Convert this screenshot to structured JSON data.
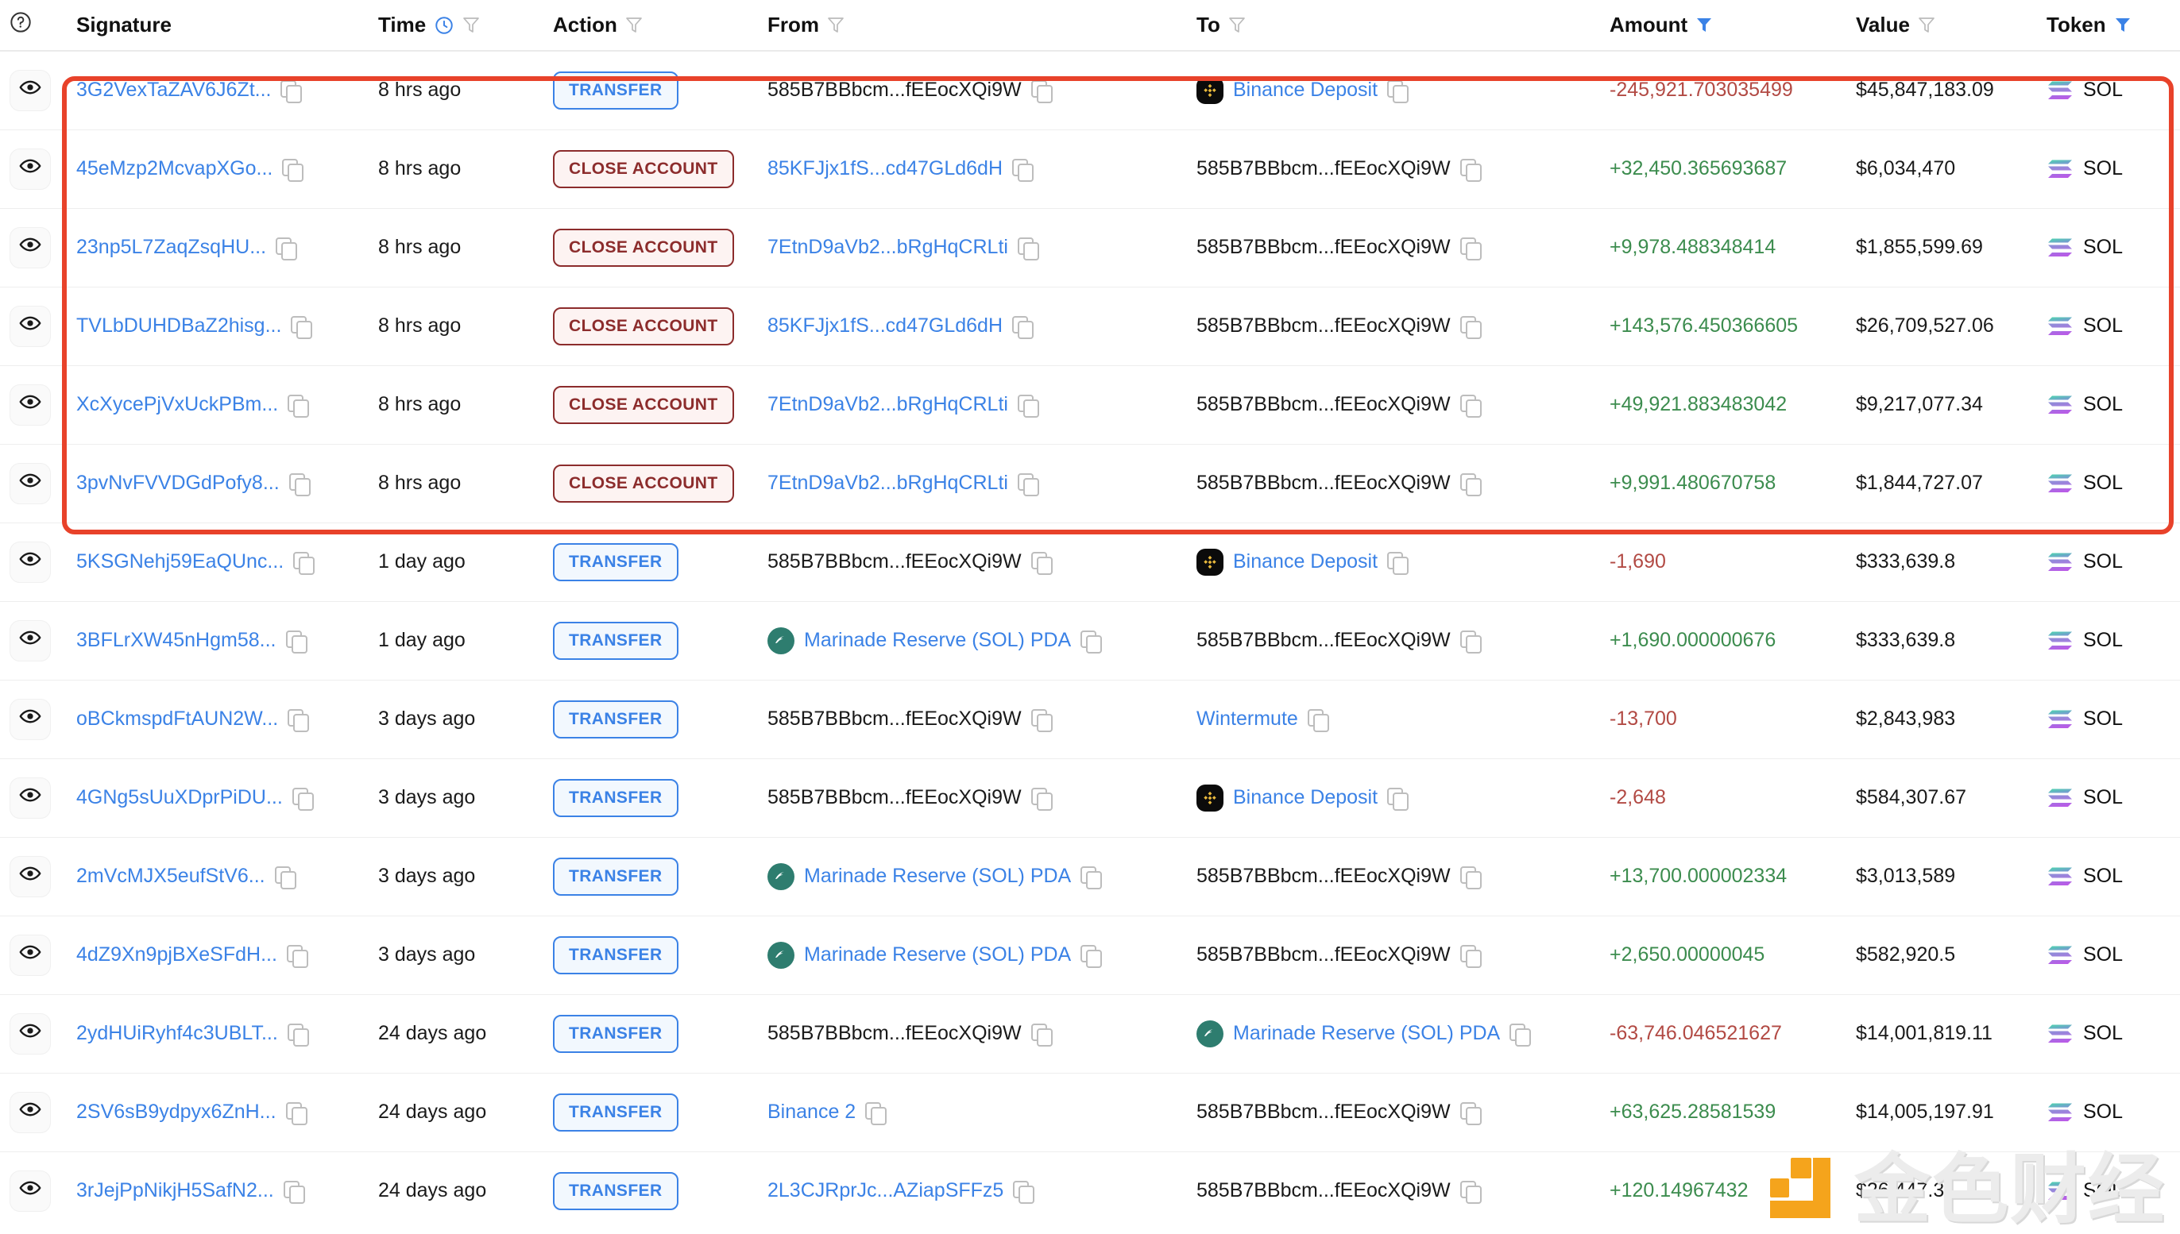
{
  "table": {
    "columns": [
      {
        "key": "eye",
        "label": "",
        "icons": [
          "help-icon"
        ]
      },
      {
        "key": "sig",
        "label": "Signature",
        "icons": []
      },
      {
        "key": "time",
        "label": "Time",
        "icons": [
          "clock-icon",
          "filter-icon"
        ]
      },
      {
        "key": "action",
        "label": "Action",
        "icons": [
          "filter-icon"
        ]
      },
      {
        "key": "from",
        "label": "From",
        "icons": [
          "filter-icon"
        ]
      },
      {
        "key": "to",
        "label": "To",
        "icons": [
          "filter-icon"
        ]
      },
      {
        "key": "amount",
        "label": "Amount",
        "icons": [
          "filter-icon-active"
        ]
      },
      {
        "key": "value",
        "label": "Value",
        "icons": [
          "filter-icon"
        ]
      },
      {
        "key": "token",
        "label": "Token",
        "icons": [
          "filter-icon-active"
        ]
      }
    ],
    "rows": [
      {
        "signature": "3G2VexTaZAV6J6Zt...",
        "time": "8 hrs ago",
        "action": "TRANSFER",
        "action_type": "transfer",
        "from": "585B7BBbcm...fEEocXQi9W",
        "from_link": false,
        "from_icon": "",
        "to": "Binance Deposit",
        "to_link": true,
        "to_icon": "binance",
        "amount": "-245,921.703035499",
        "amount_sign": "neg",
        "value": "$45,847,183.09",
        "token": "SOL",
        "highlighted": true
      },
      {
        "signature": "45eMzp2McvapXGo...",
        "time": "8 hrs ago",
        "action": "CLOSE ACCOUNT",
        "action_type": "close",
        "from": "85KFJjx1fS...cd47GLd6dH",
        "from_link": true,
        "from_icon": "",
        "to": "585B7BBbcm...fEEocXQi9W",
        "to_link": false,
        "to_icon": "",
        "amount": "+32,450.365693687",
        "amount_sign": "pos",
        "value": "$6,034,470",
        "token": "SOL",
        "highlighted": true
      },
      {
        "signature": "23np5L7ZaqZsqHU...",
        "time": "8 hrs ago",
        "action": "CLOSE ACCOUNT",
        "action_type": "close",
        "from": "7EtnD9aVb2...bRgHqCRLti",
        "from_link": true,
        "from_icon": "",
        "to": "585B7BBbcm...fEEocXQi9W",
        "to_link": false,
        "to_icon": "",
        "amount": "+9,978.488348414",
        "amount_sign": "pos",
        "value": "$1,855,599.69",
        "token": "SOL",
        "highlighted": true
      },
      {
        "signature": "TVLbDUHDBaZ2hisg...",
        "time": "8 hrs ago",
        "action": "CLOSE ACCOUNT",
        "action_type": "close",
        "from": "85KFJjx1fS...cd47GLd6dH",
        "from_link": true,
        "from_icon": "",
        "to": "585B7BBbcm...fEEocXQi9W",
        "to_link": false,
        "to_icon": "",
        "amount": "+143,576.450366605",
        "amount_sign": "pos",
        "value": "$26,709,527.06",
        "token": "SOL",
        "highlighted": true
      },
      {
        "signature": "XcXycePjVxUckPBm...",
        "time": "8 hrs ago",
        "action": "CLOSE ACCOUNT",
        "action_type": "close",
        "from": "7EtnD9aVb2...bRgHqCRLti",
        "from_link": true,
        "from_icon": "",
        "to": "585B7BBbcm...fEEocXQi9W",
        "to_link": false,
        "to_icon": "",
        "amount": "+49,921.883483042",
        "amount_sign": "pos",
        "value": "$9,217,077.34",
        "token": "SOL",
        "highlighted": true
      },
      {
        "signature": "3pvNvFVVDGdPofy8...",
        "time": "8 hrs ago",
        "action": "CLOSE ACCOUNT",
        "action_type": "close",
        "from": "7EtnD9aVb2...bRgHqCRLti",
        "from_link": true,
        "from_icon": "",
        "to": "585B7BBbcm...fEEocXQi9W",
        "to_link": false,
        "to_icon": "",
        "amount": "+9,991.480670758",
        "amount_sign": "pos",
        "value": "$1,844,727.07",
        "token": "SOL",
        "highlighted": true
      },
      {
        "signature": "5KSGNehj59EaQUnc...",
        "time": "1 day ago",
        "action": "TRANSFER",
        "action_type": "transfer",
        "from": "585B7BBbcm...fEEocXQi9W",
        "from_link": false,
        "from_icon": "",
        "to": "Binance Deposit",
        "to_link": true,
        "to_icon": "binance",
        "amount": "-1,690",
        "amount_sign": "neg",
        "value": "$333,639.8",
        "token": "SOL",
        "highlighted": false
      },
      {
        "signature": "3BFLrXW45nHgm58...",
        "time": "1 day ago",
        "action": "TRANSFER",
        "action_type": "transfer",
        "from": "Marinade Reserve (SOL) PDA",
        "from_link": true,
        "from_icon": "marinade",
        "to": "585B7BBbcm...fEEocXQi9W",
        "to_link": false,
        "to_icon": "",
        "amount": "+1,690.000000676",
        "amount_sign": "pos",
        "value": "$333,639.8",
        "token": "SOL",
        "highlighted": false
      },
      {
        "signature": "oBCkmspdFtAUN2W...",
        "time": "3 days ago",
        "action": "TRANSFER",
        "action_type": "transfer",
        "from": "585B7BBbcm...fEEocXQi9W",
        "from_link": false,
        "from_icon": "",
        "to": "Wintermute",
        "to_link": true,
        "to_icon": "",
        "amount": "-13,700",
        "amount_sign": "neg",
        "value": "$2,843,983",
        "token": "SOL",
        "highlighted": false
      },
      {
        "signature": "4GNg5sUuXDprPiDU...",
        "time": "3 days ago",
        "action": "TRANSFER",
        "action_type": "transfer",
        "from": "585B7BBbcm...fEEocXQi9W",
        "from_link": false,
        "from_icon": "",
        "to": "Binance Deposit",
        "to_link": true,
        "to_icon": "binance",
        "amount": "-2,648",
        "amount_sign": "neg",
        "value": "$584,307.67",
        "token": "SOL",
        "highlighted": false
      },
      {
        "signature": "2mVcMJX5eufStV6...",
        "time": "3 days ago",
        "action": "TRANSFER",
        "action_type": "transfer",
        "from": "Marinade Reserve (SOL) PDA",
        "from_link": true,
        "from_icon": "marinade",
        "to": "585B7BBbcm...fEEocXQi9W",
        "to_link": false,
        "to_icon": "",
        "amount": "+13,700.000002334",
        "amount_sign": "pos",
        "value": "$3,013,589",
        "token": "SOL",
        "highlighted": false
      },
      {
        "signature": "4dZ9Xn9pjBXeSFdH...",
        "time": "3 days ago",
        "action": "TRANSFER",
        "action_type": "transfer",
        "from": "Marinade Reserve (SOL) PDA",
        "from_link": true,
        "from_icon": "marinade",
        "to": "585B7BBbcm...fEEocXQi9W",
        "to_link": false,
        "to_icon": "",
        "amount": "+2,650.00000045",
        "amount_sign": "pos",
        "value": "$582,920.5",
        "token": "SOL",
        "highlighted": false
      },
      {
        "signature": "2ydHUiRyhf4c3UBLT...",
        "time": "24 days ago",
        "action": "TRANSFER",
        "action_type": "transfer",
        "from": "585B7BBbcm...fEEocXQi9W",
        "from_link": false,
        "from_icon": "",
        "to": "Marinade Reserve (SOL) PDA",
        "to_link": true,
        "to_icon": "marinade",
        "amount": "-63,746.046521627",
        "amount_sign": "neg",
        "value": "$14,001,819.11",
        "token": "SOL",
        "highlighted": false
      },
      {
        "signature": "2SV6sB9ydpyx6ZnH...",
        "time": "24 days ago",
        "action": "TRANSFER",
        "action_type": "transfer",
        "from": "Binance 2",
        "from_link": true,
        "from_icon": "",
        "to": "585B7BBbcm...fEEocXQi9W",
        "to_link": false,
        "to_icon": "",
        "amount": "+63,625.28581539",
        "amount_sign": "pos",
        "value": "$14,005,197.91",
        "token": "SOL",
        "highlighted": false
      },
      {
        "signature": "3rJejPpNikjH5SafN2...",
        "time": "24 days ago",
        "action": "TRANSFER",
        "action_type": "transfer",
        "from": "2L3CJRprJc...AZiapSFFz5",
        "from_link": true,
        "from_icon": "",
        "to": "585B7BBbcm...fEEocXQi9W",
        "to_link": false,
        "to_icon": "",
        "amount": "+120.14967432",
        "amount_sign": "pos",
        "value": "$26,447.34",
        "token": "SOL",
        "highlighted": false
      }
    ]
  },
  "watermark": {
    "text": "金色财经"
  },
  "colors": {
    "link": "#3B82E6",
    "positive": "#3C8C4E",
    "negative": "#B24A44",
    "transfer_badge": "#3B82E6",
    "close_badge": "#8C2C2C",
    "highlight_box": "#E8422A",
    "filter_active": "#3B82E6",
    "filter_inactive": "#BBBBBB"
  }
}
